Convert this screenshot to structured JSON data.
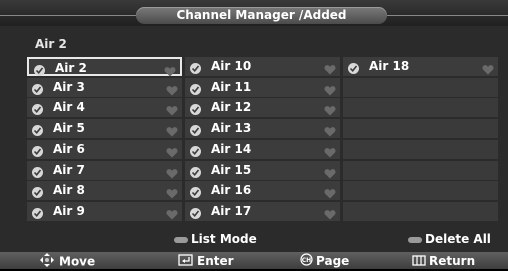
{
  "header": {
    "title": "Channel Manager /Added"
  },
  "current_channel": "Air 2",
  "columns": [
    [
      "Air 2",
      "Air 3",
      "Air 4",
      "Air 5",
      "Air 6",
      "Air 7",
      "Air 8",
      "Air 9"
    ],
    [
      "Air 10",
      "Air 11",
      "Air 12",
      "Air 13",
      "Air 14",
      "Air 15",
      "Air 16",
      "Air 17"
    ],
    [
      "Air 18",
      "",
      "",
      "",
      "",
      "",
      "",
      ""
    ]
  ],
  "selected": "Air 2",
  "actions": {
    "list_mode": "List Mode",
    "delete_all": "Delete All"
  },
  "footer": {
    "move": "Move",
    "enter": "Enter",
    "page": "Page",
    "return": "Return"
  },
  "icons": [
    "check-icon",
    "heart-icon",
    "move-icon",
    "enter-icon",
    "page-icon",
    "return-icon"
  ],
  "colors": {
    "background": "#2b2b2b",
    "cell": "#3c3c3c",
    "selected_border": "#e8e8e8",
    "button": "#9a9a9a"
  }
}
